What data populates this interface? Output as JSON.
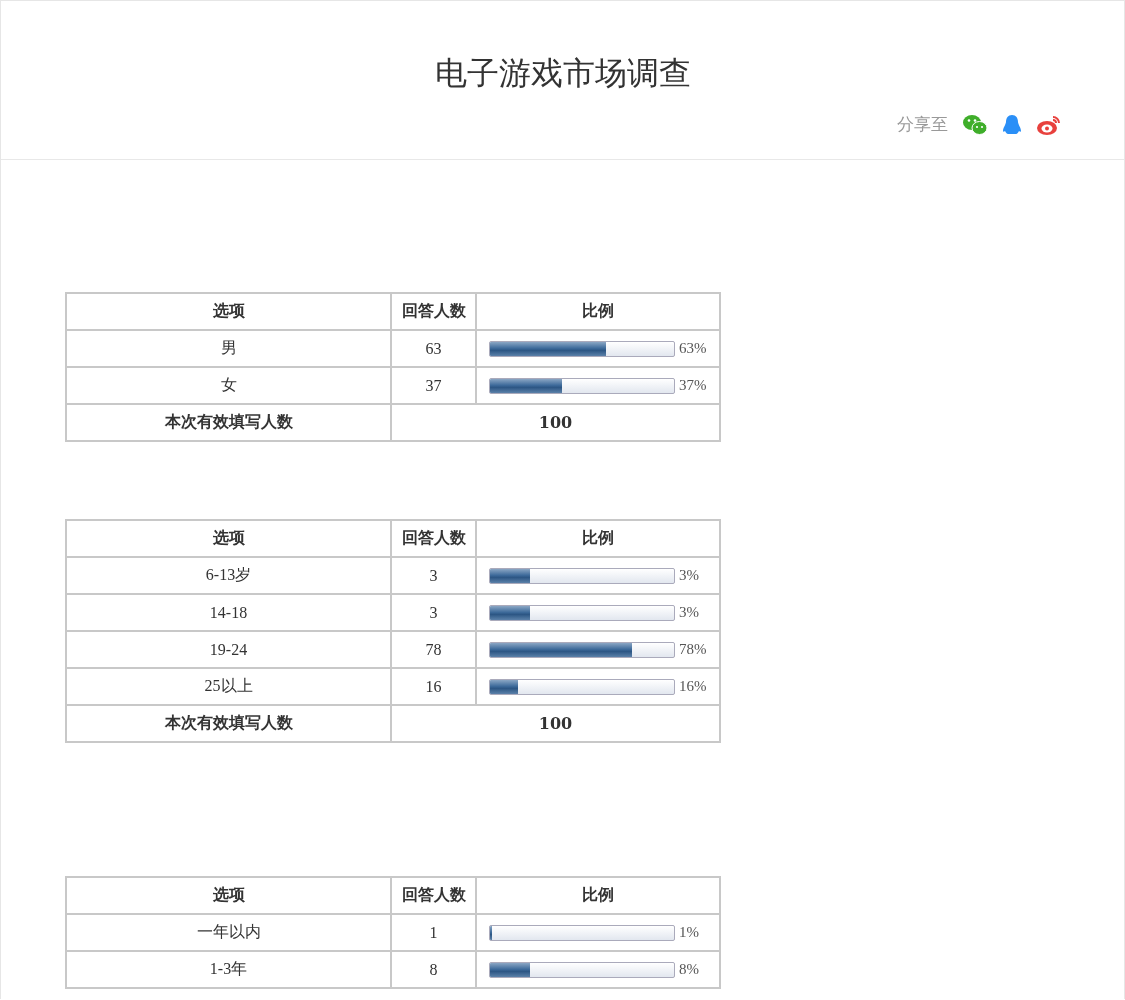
{
  "title": "电子游戏市场调查",
  "share": {
    "label": "分享至"
  },
  "tables": [
    {
      "columns": [
        "选项",
        "回答人数",
        "比例"
      ],
      "rows": [
        {
          "option": "男",
          "count": "63",
          "level": 0.63,
          "percent": "63%"
        },
        {
          "option": "女",
          "count": "37",
          "level": 0.39,
          "percent": "37%"
        }
      ],
      "total_label": "本次有效填写人数",
      "total": "100"
    },
    {
      "columns": [
        "选项",
        "回答人数",
        "比例"
      ],
      "rows": [
        {
          "option": "6-13岁",
          "count": "3",
          "level": 0.22,
          "percent": "3%"
        },
        {
          "option": "14-18",
          "count": "3",
          "level": 0.22,
          "percent": "3%"
        },
        {
          "option": "19-24",
          "count": "78",
          "level": 0.77,
          "percent": "78%"
        },
        {
          "option": "25以上",
          "count": "16",
          "level": 0.15,
          "percent": "16%"
        }
      ],
      "total_label": "本次有效填写人数",
      "total": "100"
    },
    {
      "columns": [
        "选项",
        "回答人数",
        "比例"
      ],
      "rows": [
        {
          "option": "一年以内",
          "count": "1",
          "level": 0.01,
          "percent": "1%"
        },
        {
          "option": "1-3年",
          "count": "8",
          "level": 0.22,
          "percent": "8%"
        }
      ]
    }
  ]
}
